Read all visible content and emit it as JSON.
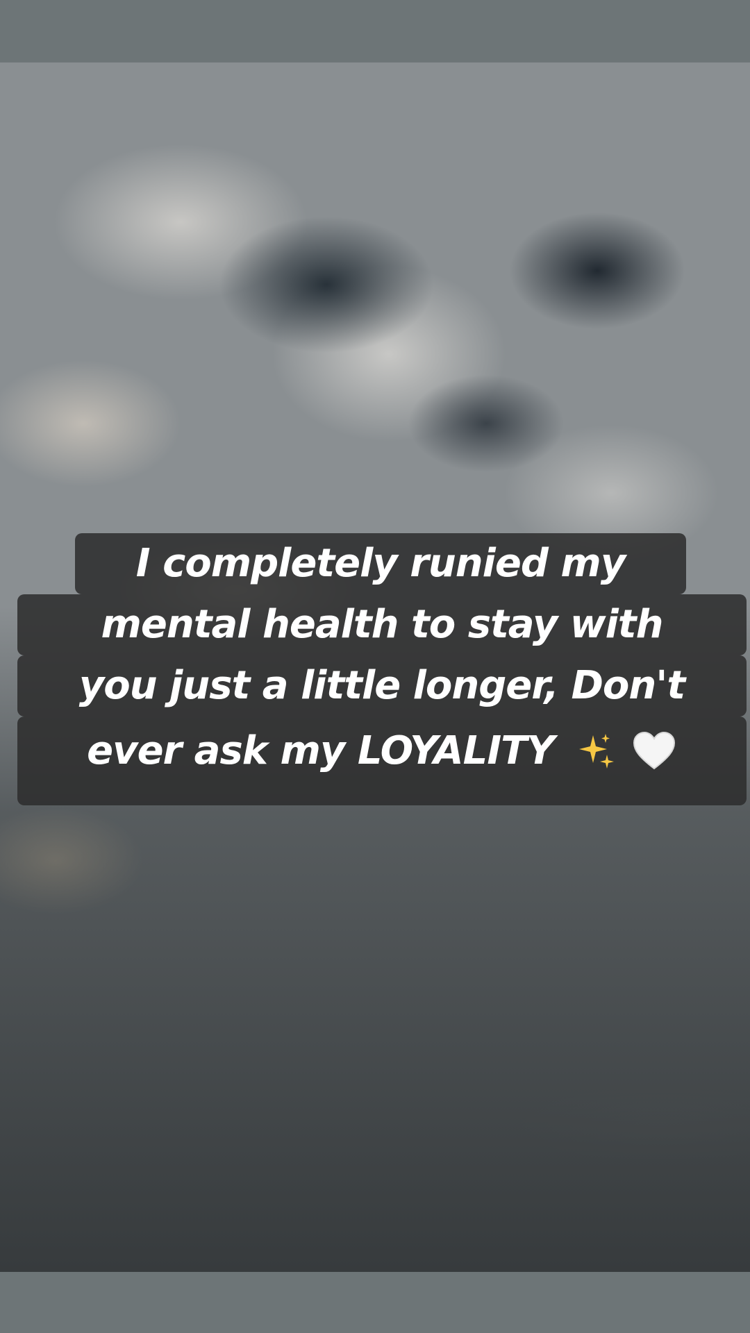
{
  "caption": {
    "lines": [
      "I completely runied my",
      "mental health to stay with",
      "you just a little longer, Don't",
      "ever ask my LOYALITY"
    ],
    "emojis": [
      "sparkles-icon",
      "white-heart-icon"
    ]
  }
}
